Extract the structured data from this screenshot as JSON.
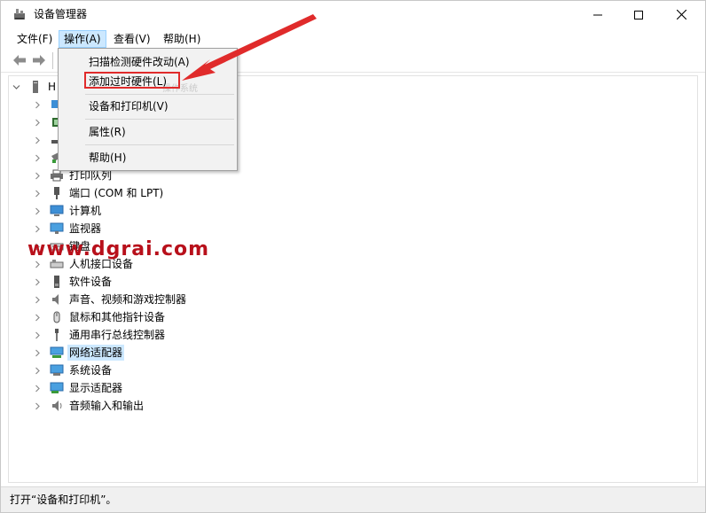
{
  "window": {
    "title": "设备管理器"
  },
  "menubar": {
    "file": "文件(F)",
    "action": "操作(A)",
    "view": "查看(V)",
    "help": "帮助(H)"
  },
  "dropdown": {
    "items": [
      {
        "label": "扫描检测硬件改动(A)"
      },
      {
        "label": "添加过时硬件(L)"
      },
      {
        "label": "设备和打印机(V)"
      },
      {
        "label": "属性(R)"
      },
      {
        "label": "帮助(H)"
      }
    ],
    "highlight_color": "#e02b2b"
  },
  "tree": {
    "root": {
      "label": "H"
    },
    "categories": [
      {
        "label": "打印队列",
        "icon": "printer-icon"
      },
      {
        "label": "端口 (COM 和 LPT)",
        "icon": "port-icon"
      },
      {
        "label": "计算机",
        "icon": "computer-icon"
      },
      {
        "label": "监视器",
        "icon": "monitor-icon"
      },
      {
        "label": "键盘",
        "icon": "keyboard-icon"
      },
      {
        "label": "人机接口设备",
        "icon": "hid-icon"
      },
      {
        "label": "软件设备",
        "icon": "software-device-icon"
      },
      {
        "label": "声音、视频和游戏控制器",
        "icon": "speaker-icon"
      },
      {
        "label": "鼠标和其他指针设备",
        "icon": "mouse-icon"
      },
      {
        "label": "通用串行总线控制器",
        "icon": "usb-icon"
      },
      {
        "label": "网络适配器",
        "icon": "network-adapter-icon",
        "selected": true
      },
      {
        "label": "系统设备",
        "icon": "system-device-icon"
      },
      {
        "label": "显示适配器",
        "icon": "display-adapter-icon"
      },
      {
        "label": "音频输入和输出",
        "icon": "audio-io-icon"
      }
    ]
  },
  "statusbar": {
    "text": "打开“设备和打印机”。"
  },
  "watermark": {
    "text": "www.dgrai.com",
    "small_text": "操作系统"
  },
  "colors": {
    "selection": "#cce8ff",
    "accent_red": "#e02b2b"
  }
}
